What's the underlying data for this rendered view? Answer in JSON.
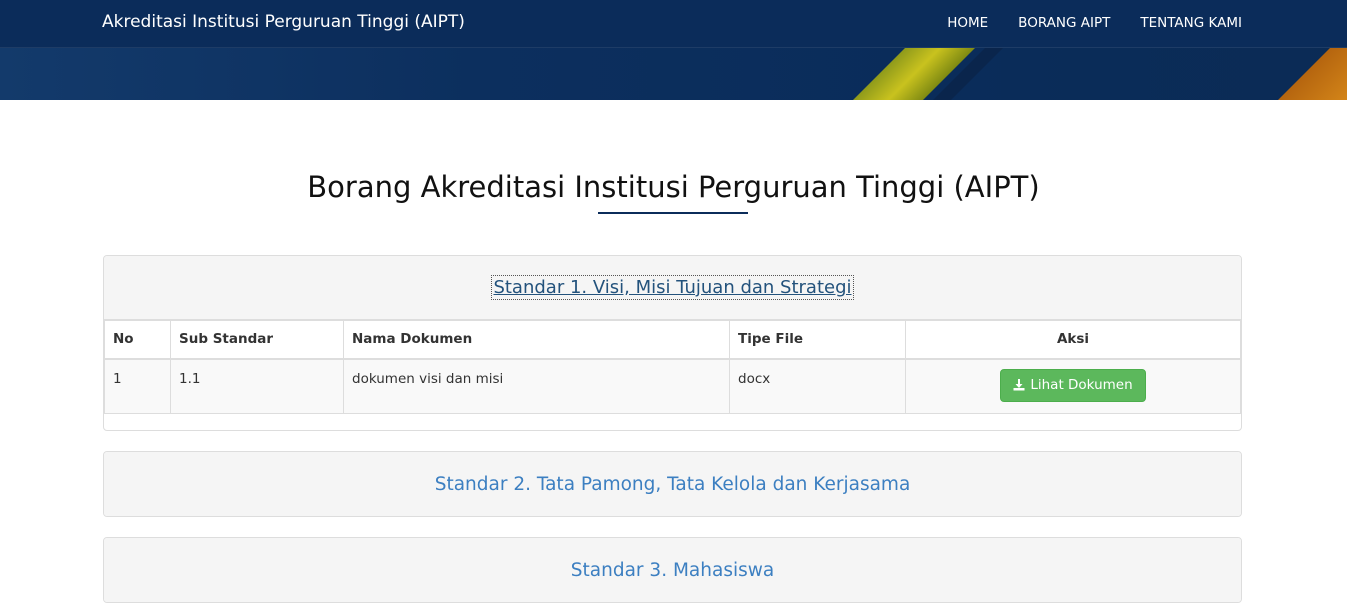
{
  "header": {
    "brand": "Akreditasi Institusi Perguruan Tinggi (AIPT)",
    "nav": [
      "HOME",
      "BORANG AIPT",
      "TENTANG KAMI"
    ]
  },
  "page": {
    "title": "Borang Akreditasi Institusi Perguruan Tinggi (AIPT)"
  },
  "panels": [
    {
      "heading": "Standar 1. Visi, Misi Tujuan dan Strategi",
      "table": {
        "headers": [
          "No",
          "Sub Standar",
          "Nama Dokumen",
          "Tipe File",
          "Aksi"
        ],
        "rows": [
          {
            "no": "1",
            "sub": "1.1",
            "nama": "dokumen visi dan misi",
            "tipe": "docx",
            "action_label": "Lihat Dokumen"
          }
        ]
      }
    },
    {
      "heading": "Standar 2. Tata Pamong, Tata Kelola dan Kerjasama"
    },
    {
      "heading": "Standar 3. Mahasiswa"
    }
  ],
  "colors": {
    "header_bg": "#0b2c5a",
    "link": "#3c7fc1",
    "success_button": "#5cb85c"
  }
}
